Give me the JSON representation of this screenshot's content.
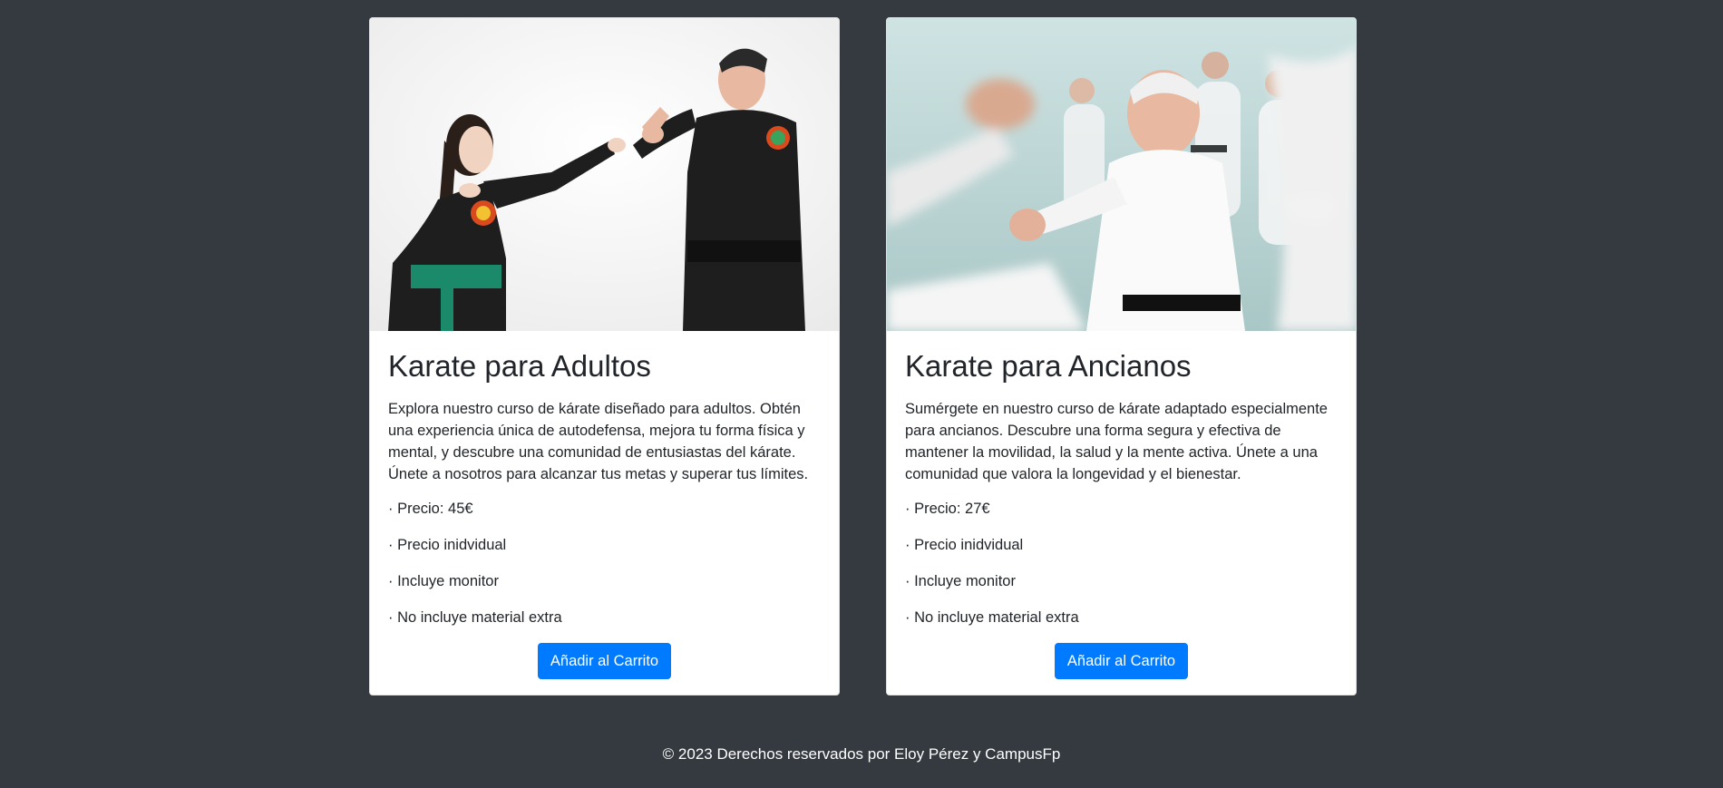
{
  "cards": [
    {
      "image_alt": "adults-karate-photo",
      "title": "Karate para Adultos",
      "description": "Explora nuestro curso de kárate diseñado para adultos. Obtén una experiencia única de autodefensa, mejora tu forma física y mental, y descubre una comunidad de entusiastas del kárate. Únete a nosotros para alcanzar tus metas y superar tus límites.",
      "features": [
        "· Precio: 45€",
        "· Precio inidvidual",
        "· Incluye monitor",
        "· No incluye material extra"
      ],
      "button_label": "Añadir al Carrito"
    },
    {
      "image_alt": "elderly-karate-photo",
      "title": "Karate para Ancianos",
      "description": "Sumérgete en nuestro curso de kárate adaptado especialmente para ancianos. Descubre una forma segura y efectiva de mantener la movilidad, la salud y la mente activa. Únete a una comunidad que valora la longevidad y el bienestar.",
      "features": [
        "· Precio: 27€",
        "· Precio inidvidual",
        "· Incluye monitor",
        "· No incluye material extra"
      ],
      "button_label": "Añadir al Carrito"
    }
  ],
  "footer": {
    "text": "© 2023 Derechos reservados por Eloy Pérez y CampusFp"
  },
  "colors": {
    "page_background": "#343a40",
    "card_background": "#ffffff",
    "button": "#007bff",
    "text": "#212529"
  }
}
